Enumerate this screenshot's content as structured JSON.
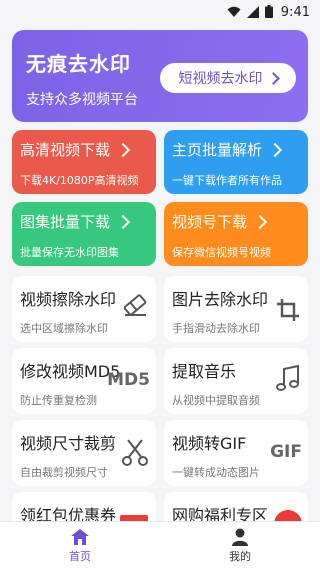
{
  "status_bar": {
    "time": "9:41"
  },
  "hero": {
    "title": "无痕去水印",
    "subtitle": "支持众多视频平台",
    "button_label": "短视频去水印"
  },
  "cards": [
    {
      "title": "高清视频下载",
      "subtitle": "下载4K/1080P高清视频",
      "color": "#ea5a4b"
    },
    {
      "title": "主页批量解析",
      "subtitle": "一键下载作者所有作品",
      "color": "#2d9ef0"
    },
    {
      "title": "图集批量下载",
      "subtitle": "批量保存无水印图集",
      "color": "#36c97d"
    },
    {
      "title": "视频号下载",
      "subtitle": "保存微信视频号视频",
      "color": "#ff8c1c"
    }
  ],
  "tools": [
    {
      "title": "视频擦除水印",
      "subtitle": "选中区域擦除水印",
      "icon": "eraser-icon"
    },
    {
      "title": "图片去除水印",
      "subtitle": "手指滑动去除水印",
      "icon": "crop-icon"
    },
    {
      "title": "修改视频MD5",
      "subtitle": "防止传重复检测",
      "icon_text": "MD5"
    },
    {
      "title": "提取音乐",
      "subtitle": "从视频中提取音频",
      "icon": "music-note-icon"
    },
    {
      "title": "视频尺寸裁剪",
      "subtitle": "自由裁剪视频尺寸",
      "icon": "scissors-icon"
    },
    {
      "title": "视频转GIF",
      "subtitle": "一键转成动态图片",
      "icon_text": "GIF"
    },
    {
      "title": "领红包优惠券",
      "icon": "red-envelope-icon"
    },
    {
      "title": "网购福利专区",
      "icon": "red-circle-icon"
    }
  ],
  "bottom_nav": [
    {
      "label": "首页",
      "icon": "home-icon",
      "active": true
    },
    {
      "label": "我的",
      "icon": "person-icon",
      "active": false
    }
  ],
  "accent_color": "#6b4fd8"
}
